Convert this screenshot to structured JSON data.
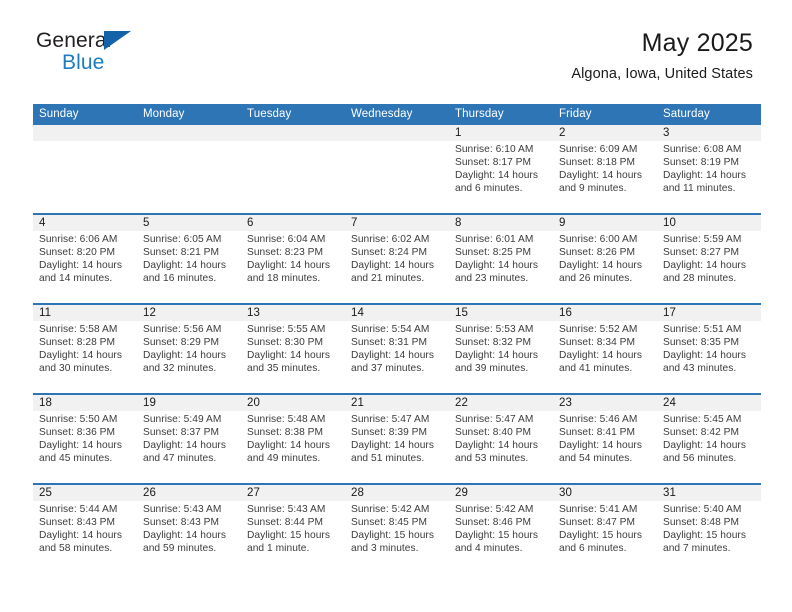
{
  "brand": {
    "word_one": "General",
    "word_two": "Blue",
    "triangle_color": "#1463a8",
    "blue_color": "#1b7cc2"
  },
  "header": {
    "title": "May 2025",
    "subtitle": "Algona, Iowa, United States"
  },
  "theme": {
    "header_blue": "#2e75b6",
    "daynum_band": "#f1f1f1",
    "text": "#3c3c3c"
  },
  "weekdays": [
    "Sunday",
    "Monday",
    "Tuesday",
    "Wednesday",
    "Thursday",
    "Friday",
    "Saturday"
  ],
  "labels": {
    "sunrise": "Sunrise:",
    "sunset": "Sunset:",
    "daylight": "Daylight:"
  },
  "weeks": [
    [
      {
        "day": "",
        "sunrise": "",
        "sunset": "",
        "daylight_1": "",
        "daylight_2": ""
      },
      {
        "day": "",
        "sunrise": "",
        "sunset": "",
        "daylight_1": "",
        "daylight_2": ""
      },
      {
        "day": "",
        "sunrise": "",
        "sunset": "",
        "daylight_1": "",
        "daylight_2": ""
      },
      {
        "day": "",
        "sunrise": "",
        "sunset": "",
        "daylight_1": "",
        "daylight_2": ""
      },
      {
        "day": "1",
        "sunrise": "Sunrise: 6:10 AM",
        "sunset": "Sunset: 8:17 PM",
        "daylight_1": "Daylight: 14 hours",
        "daylight_2": "and 6 minutes."
      },
      {
        "day": "2",
        "sunrise": "Sunrise: 6:09 AM",
        "sunset": "Sunset: 8:18 PM",
        "daylight_1": "Daylight: 14 hours",
        "daylight_2": "and 9 minutes."
      },
      {
        "day": "3",
        "sunrise": "Sunrise: 6:08 AM",
        "sunset": "Sunset: 8:19 PM",
        "daylight_1": "Daylight: 14 hours",
        "daylight_2": "and 11 minutes."
      }
    ],
    [
      {
        "day": "4",
        "sunrise": "Sunrise: 6:06 AM",
        "sunset": "Sunset: 8:20 PM",
        "daylight_1": "Daylight: 14 hours",
        "daylight_2": "and 14 minutes."
      },
      {
        "day": "5",
        "sunrise": "Sunrise: 6:05 AM",
        "sunset": "Sunset: 8:21 PM",
        "daylight_1": "Daylight: 14 hours",
        "daylight_2": "and 16 minutes."
      },
      {
        "day": "6",
        "sunrise": "Sunrise: 6:04 AM",
        "sunset": "Sunset: 8:23 PM",
        "daylight_1": "Daylight: 14 hours",
        "daylight_2": "and 18 minutes."
      },
      {
        "day": "7",
        "sunrise": "Sunrise: 6:02 AM",
        "sunset": "Sunset: 8:24 PM",
        "daylight_1": "Daylight: 14 hours",
        "daylight_2": "and 21 minutes."
      },
      {
        "day": "8",
        "sunrise": "Sunrise: 6:01 AM",
        "sunset": "Sunset: 8:25 PM",
        "daylight_1": "Daylight: 14 hours",
        "daylight_2": "and 23 minutes."
      },
      {
        "day": "9",
        "sunrise": "Sunrise: 6:00 AM",
        "sunset": "Sunset: 8:26 PM",
        "daylight_1": "Daylight: 14 hours",
        "daylight_2": "and 26 minutes."
      },
      {
        "day": "10",
        "sunrise": "Sunrise: 5:59 AM",
        "sunset": "Sunset: 8:27 PM",
        "daylight_1": "Daylight: 14 hours",
        "daylight_2": "and 28 minutes."
      }
    ],
    [
      {
        "day": "11",
        "sunrise": "Sunrise: 5:58 AM",
        "sunset": "Sunset: 8:28 PM",
        "daylight_1": "Daylight: 14 hours",
        "daylight_2": "and 30 minutes."
      },
      {
        "day": "12",
        "sunrise": "Sunrise: 5:56 AM",
        "sunset": "Sunset: 8:29 PM",
        "daylight_1": "Daylight: 14 hours",
        "daylight_2": "and 32 minutes."
      },
      {
        "day": "13",
        "sunrise": "Sunrise: 5:55 AM",
        "sunset": "Sunset: 8:30 PM",
        "daylight_1": "Daylight: 14 hours",
        "daylight_2": "and 35 minutes."
      },
      {
        "day": "14",
        "sunrise": "Sunrise: 5:54 AM",
        "sunset": "Sunset: 8:31 PM",
        "daylight_1": "Daylight: 14 hours",
        "daylight_2": "and 37 minutes."
      },
      {
        "day": "15",
        "sunrise": "Sunrise: 5:53 AM",
        "sunset": "Sunset: 8:32 PM",
        "daylight_1": "Daylight: 14 hours",
        "daylight_2": "and 39 minutes."
      },
      {
        "day": "16",
        "sunrise": "Sunrise: 5:52 AM",
        "sunset": "Sunset: 8:34 PM",
        "daylight_1": "Daylight: 14 hours",
        "daylight_2": "and 41 minutes."
      },
      {
        "day": "17",
        "sunrise": "Sunrise: 5:51 AM",
        "sunset": "Sunset: 8:35 PM",
        "daylight_1": "Daylight: 14 hours",
        "daylight_2": "and 43 minutes."
      }
    ],
    [
      {
        "day": "18",
        "sunrise": "Sunrise: 5:50 AM",
        "sunset": "Sunset: 8:36 PM",
        "daylight_1": "Daylight: 14 hours",
        "daylight_2": "and 45 minutes."
      },
      {
        "day": "19",
        "sunrise": "Sunrise: 5:49 AM",
        "sunset": "Sunset: 8:37 PM",
        "daylight_1": "Daylight: 14 hours",
        "daylight_2": "and 47 minutes."
      },
      {
        "day": "20",
        "sunrise": "Sunrise: 5:48 AM",
        "sunset": "Sunset: 8:38 PM",
        "daylight_1": "Daylight: 14 hours",
        "daylight_2": "and 49 minutes."
      },
      {
        "day": "21",
        "sunrise": "Sunrise: 5:47 AM",
        "sunset": "Sunset: 8:39 PM",
        "daylight_1": "Daylight: 14 hours",
        "daylight_2": "and 51 minutes."
      },
      {
        "day": "22",
        "sunrise": "Sunrise: 5:47 AM",
        "sunset": "Sunset: 8:40 PM",
        "daylight_1": "Daylight: 14 hours",
        "daylight_2": "and 53 minutes."
      },
      {
        "day": "23",
        "sunrise": "Sunrise: 5:46 AM",
        "sunset": "Sunset: 8:41 PM",
        "daylight_1": "Daylight: 14 hours",
        "daylight_2": "and 54 minutes."
      },
      {
        "day": "24",
        "sunrise": "Sunrise: 5:45 AM",
        "sunset": "Sunset: 8:42 PM",
        "daylight_1": "Daylight: 14 hours",
        "daylight_2": "and 56 minutes."
      }
    ],
    [
      {
        "day": "25",
        "sunrise": "Sunrise: 5:44 AM",
        "sunset": "Sunset: 8:43 PM",
        "daylight_1": "Daylight: 14 hours",
        "daylight_2": "and 58 minutes."
      },
      {
        "day": "26",
        "sunrise": "Sunrise: 5:43 AM",
        "sunset": "Sunset: 8:43 PM",
        "daylight_1": "Daylight: 14 hours",
        "daylight_2": "and 59 minutes."
      },
      {
        "day": "27",
        "sunrise": "Sunrise: 5:43 AM",
        "sunset": "Sunset: 8:44 PM",
        "daylight_1": "Daylight: 15 hours",
        "daylight_2": "and 1 minute."
      },
      {
        "day": "28",
        "sunrise": "Sunrise: 5:42 AM",
        "sunset": "Sunset: 8:45 PM",
        "daylight_1": "Daylight: 15 hours",
        "daylight_2": "and 3 minutes."
      },
      {
        "day": "29",
        "sunrise": "Sunrise: 5:42 AM",
        "sunset": "Sunset: 8:46 PM",
        "daylight_1": "Daylight: 15 hours",
        "daylight_2": "and 4 minutes."
      },
      {
        "day": "30",
        "sunrise": "Sunrise: 5:41 AM",
        "sunset": "Sunset: 8:47 PM",
        "daylight_1": "Daylight: 15 hours",
        "daylight_2": "and 6 minutes."
      },
      {
        "day": "31",
        "sunrise": "Sunrise: 5:40 AM",
        "sunset": "Sunset: 8:48 PM",
        "daylight_1": "Daylight: 15 hours",
        "daylight_2": "and 7 minutes."
      }
    ]
  ]
}
